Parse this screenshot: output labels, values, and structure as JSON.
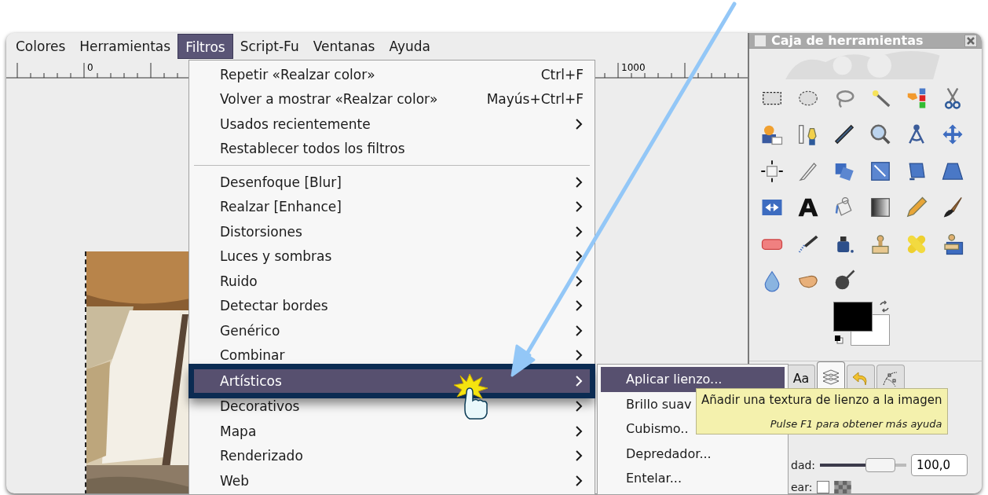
{
  "menubar": [
    {
      "label": "Colores",
      "selected": false
    },
    {
      "label": "Herramientas",
      "selected": false
    },
    {
      "label": "Filtros",
      "selected": true
    },
    {
      "label": "Script-Fu",
      "selected": false
    },
    {
      "label": "Ventanas",
      "selected": false
    },
    {
      "label": "Ayuda",
      "selected": false
    }
  ],
  "ruler": {
    "labels": [
      "0",
      "1000"
    ]
  },
  "filters_menu": {
    "items": [
      {
        "kind": "action",
        "label": "Repetir «Realzar color»",
        "shortcut": "Ctrl+F",
        "selected": false
      },
      {
        "kind": "action",
        "label": "Volver a mostrar «Realzar color»",
        "shortcut": "Mayús+Ctrl+F",
        "selected": false
      },
      {
        "kind": "submenu",
        "label": "Usados recientemente",
        "selected": false
      },
      {
        "kind": "action",
        "label": "Restablecer todos los filtros",
        "selected": false
      },
      {
        "kind": "separator"
      },
      {
        "kind": "submenu",
        "label": "Desenfoque [Blur]",
        "selected": false
      },
      {
        "kind": "submenu",
        "label": "Realzar [Enhance]",
        "selected": false
      },
      {
        "kind": "submenu",
        "label": "Distorsiones",
        "selected": false
      },
      {
        "kind": "submenu",
        "label": "Luces y sombras",
        "selected": false
      },
      {
        "kind": "submenu",
        "label": "Ruido",
        "selected": false
      },
      {
        "kind": "submenu",
        "label": "Detectar bordes",
        "selected": false
      },
      {
        "kind": "submenu",
        "label": "Genérico",
        "selected": false
      },
      {
        "kind": "submenu",
        "label": "Combinar",
        "selected": false
      },
      {
        "kind": "submenu",
        "label": "Artísticos",
        "selected": true
      },
      {
        "kind": "submenu",
        "label": "Decorativos",
        "selected": false
      },
      {
        "kind": "submenu",
        "label": "Mapa",
        "selected": false
      },
      {
        "kind": "submenu",
        "label": "Renderizado",
        "selected": false
      },
      {
        "kind": "submenu",
        "label": "Web",
        "selected": false
      }
    ]
  },
  "artistic_submenu": {
    "items": [
      {
        "label": "Aplicar lienzo...",
        "selected": true
      },
      {
        "label": "Brillo suav",
        "selected": false
      },
      {
        "label": "Cubismo..",
        "selected": false
      },
      {
        "label": "Depredador...",
        "selected": false
      },
      {
        "label": "Entelar...",
        "selected": false
      }
    ]
  },
  "tooltip": {
    "text": "Añadir una textura de lienzo a la imagen",
    "hint": "Pulse F1 para obtener más ayuda"
  },
  "toolbox": {
    "title": "Caja de herramientas",
    "tabs": [
      {
        "kind": "text",
        "label": "Aa",
        "selected": false
      },
      {
        "kind": "layers",
        "selected": true
      },
      {
        "kind": "undo",
        "selected": false
      },
      {
        "kind": "paths",
        "selected": false
      }
    ],
    "options": {
      "slider_label": "dad:",
      "level": 0.85,
      "value": "100,0",
      "checkbox_label": "ear:",
      "checked": false
    }
  }
}
